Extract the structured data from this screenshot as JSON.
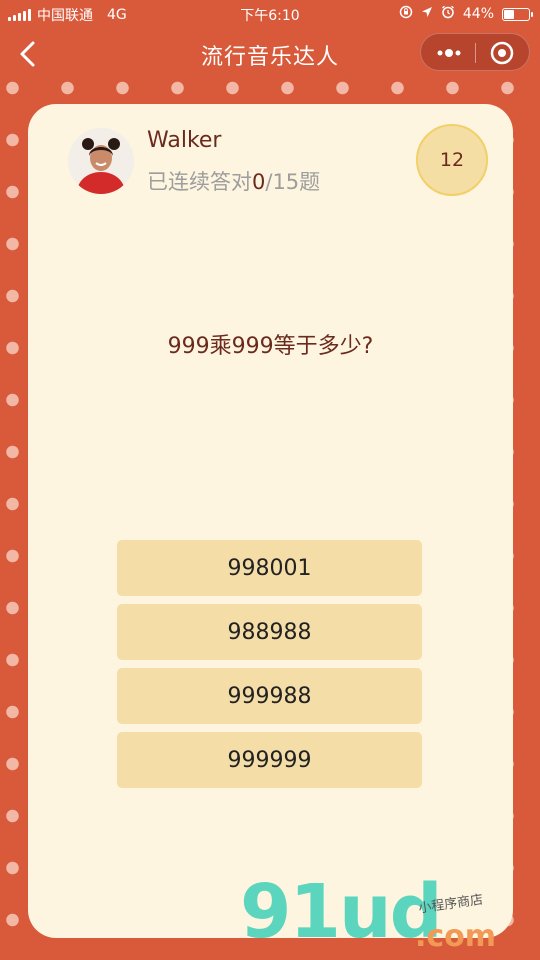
{
  "status_bar": {
    "carrier": "中国联通",
    "network": "4G",
    "time": "下午6:10",
    "battery": "44%",
    "battery_level": 0.44
  },
  "nav": {
    "title": "流行音乐达人"
  },
  "player": {
    "name": "Walker",
    "streak_prefix": "已连续答对",
    "streak_count": "0",
    "streak_suffix": "/15题"
  },
  "timer": "12",
  "question": "999乘999等于多少?",
  "options": [
    "998001",
    "988988",
    "999988",
    "999999"
  ],
  "watermark": {
    "logo": "91ud",
    "dotcom": ".com",
    "subtitle": "小程序商店"
  },
  "colors": {
    "background": "#d95a3b",
    "card": "#fdf5df",
    "option": "#f5dda8",
    "timer": "#f5dea4",
    "accent_text": "#6b2a1e"
  }
}
